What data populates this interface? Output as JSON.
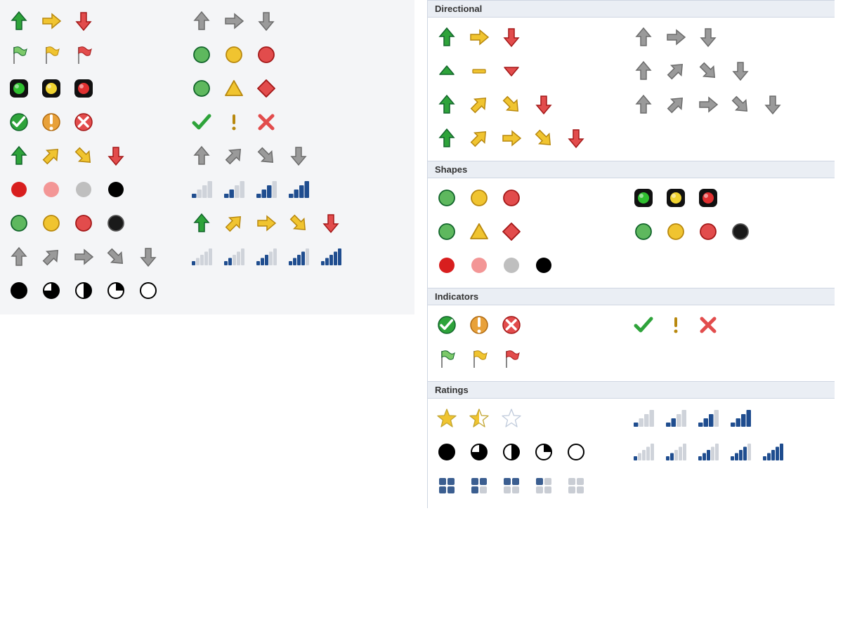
{
  "categories": {
    "directional": "Directional",
    "shapes": "Shapes",
    "indicators": "Indicators",
    "ratings": "Ratings"
  },
  "left_panel": {
    "rows": [
      {
        "a": [
          "arrow-up-green",
          "arrow-right-yellow",
          "arrow-down-red"
        ],
        "b": [
          "arrow-up-gray",
          "arrow-right-gray",
          "arrow-down-gray"
        ]
      },
      {
        "a": [
          "flag-green",
          "flag-yellow",
          "flag-red"
        ],
        "b": [
          "circle-green",
          "circle-yellow",
          "circle-red"
        ]
      },
      {
        "a": [
          "light-green",
          "light-yellow",
          "light-red"
        ],
        "b": [
          "circle-green",
          "triangle-yellow",
          "diamond-red"
        ]
      },
      {
        "a": [
          "badge-check-green",
          "badge-exclaim-yellow",
          "badge-x-red"
        ],
        "b": [
          "check-green",
          "exclaim-yellow",
          "x-red"
        ]
      },
      {
        "a": [
          "arrow-up-green",
          "arrow-ur-yellow",
          "arrow-dr-yellow",
          "arrow-down-red"
        ],
        "b": [
          "arrow-up-gray",
          "arrow-ur-gray",
          "arrow-dr-gray",
          "arrow-down-gray"
        ]
      },
      {
        "a": [
          "ball-red",
          "ball-pink",
          "ball-silver",
          "ball-black"
        ],
        "b": [
          "bars-4-1",
          "bars-4-2",
          "bars-4-3",
          "bars-4-4"
        ]
      },
      {
        "a": [
          "circle-green",
          "circle-yellow",
          "circle-red",
          "ball-black-rim"
        ],
        "b": [
          "arrow-up-green",
          "arrow-ur-yellow",
          "arrow-right-yellow",
          "arrow-dr-yellow",
          "arrow-down-red"
        ]
      },
      {
        "a": [
          "arrow-up-gray",
          "arrow-ur-gray",
          "arrow-right-gray",
          "arrow-dr-gray",
          "arrow-down-gray"
        ],
        "b": [
          "bars-5-1",
          "bars-5-2",
          "bars-5-3",
          "bars-5-4",
          "bars-5-5"
        ]
      },
      {
        "a": [
          "pie-4",
          "pie-3",
          "pie-2",
          "pie-1",
          "pie-0"
        ],
        "b": []
      }
    ]
  },
  "right_panel": {
    "directional": [
      {
        "a": [
          "arrow-up-green",
          "arrow-right-yellow",
          "arrow-down-red"
        ],
        "b": [
          "arrow-up-gray",
          "arrow-right-gray",
          "arrow-down-gray"
        ]
      },
      {
        "a": [
          "tri-up-green",
          "dash-yellow",
          "tri-down-red"
        ],
        "b": [
          "arrow-up-gray",
          "arrow-ur-gray",
          "arrow-dr-gray",
          "arrow-down-gray"
        ]
      },
      {
        "a": [
          "arrow-up-green",
          "arrow-ur-yellow",
          "arrow-dr-yellow",
          "arrow-down-red"
        ],
        "b": [
          "arrow-up-gray",
          "arrow-ur-gray",
          "arrow-right-gray",
          "arrow-dr-gray",
          "arrow-down-gray"
        ]
      },
      {
        "a": [
          "arrow-up-green",
          "arrow-ur-yellow",
          "arrow-right-yellow",
          "arrow-dr-yellow",
          "arrow-down-red"
        ],
        "b": []
      }
    ],
    "shapes": [
      {
        "a": [
          "circle-green",
          "circle-yellow",
          "circle-red"
        ],
        "b": [
          "light-green",
          "light-yellow",
          "light-red"
        ]
      },
      {
        "a": [
          "circle-green",
          "triangle-yellow",
          "diamond-red"
        ],
        "b": [
          "circle-green",
          "circle-yellow",
          "circle-red",
          "ball-black-rim"
        ]
      },
      {
        "a": [
          "ball-red",
          "ball-pink",
          "ball-silver",
          "ball-black"
        ],
        "b": []
      }
    ],
    "indicators": [
      {
        "a": [
          "badge-check-green",
          "badge-exclaim-yellow",
          "badge-x-red"
        ],
        "b": [
          "check-green",
          "exclaim-yellow",
          "x-red"
        ]
      },
      {
        "a": [
          "flag-green",
          "flag-yellow",
          "flag-red"
        ],
        "b": []
      }
    ],
    "ratings": [
      {
        "a": [
          "star-full",
          "star-half",
          "star-empty"
        ],
        "b": [
          "bars-4-1",
          "bars-4-2",
          "bars-4-3",
          "bars-4-4"
        ]
      },
      {
        "a": [
          "pie-4",
          "pie-3",
          "pie-2",
          "pie-1",
          "pie-0"
        ],
        "b": [
          "bars-5-1",
          "bars-5-2",
          "bars-5-3",
          "bars-5-4",
          "bars-5-5"
        ]
      },
      {
        "a": [
          "boxes-4",
          "boxes-3",
          "boxes-2",
          "boxes-1",
          "boxes-0"
        ],
        "b": []
      }
    ]
  }
}
